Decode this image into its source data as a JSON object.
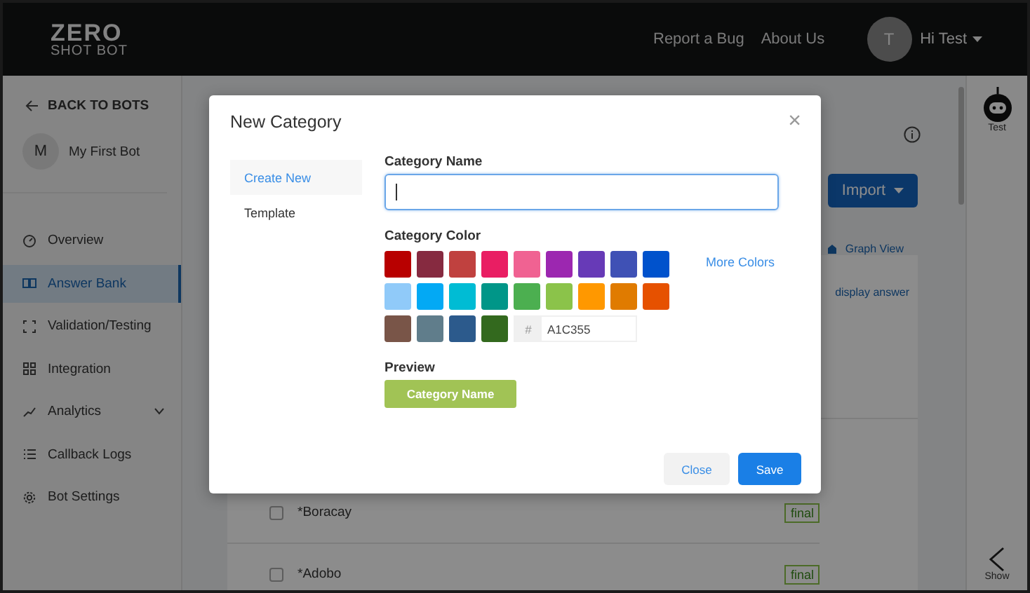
{
  "header": {
    "logo": {
      "word": "ZERO",
      "subtitle": "SHOT BOT"
    },
    "links": [
      "Report a Bug",
      "About Us"
    ],
    "user": {
      "initial": "T",
      "greeting": "Hi Test"
    }
  },
  "sidebar": {
    "back": "BACK TO BOTS",
    "bot": {
      "initial": "M",
      "name": "My First Bot"
    },
    "items": [
      {
        "label": "Overview",
        "kind": "link",
        "selected": false
      },
      {
        "label": "Answer Bank",
        "kind": "link",
        "selected": true
      },
      {
        "label": "Validation/Testing",
        "kind": "link",
        "selected": false
      },
      {
        "label": "Integration",
        "kind": "link",
        "selected": false
      },
      {
        "label": "Analytics",
        "kind": "group",
        "selected": false
      },
      {
        "label": "Callback Logs",
        "kind": "link",
        "selected": false
      },
      {
        "label": "Bot Settings",
        "kind": "link",
        "selected": false
      }
    ]
  },
  "main": {
    "import_button": "Import",
    "graph_view": "Graph View",
    "cut_text": "display answer",
    "rows": [
      {
        "name": "*Boracay",
        "checked": false,
        "status": "final"
      },
      {
        "name": "*Adobo",
        "checked": false,
        "status": "final"
      }
    ]
  },
  "rail": {
    "test": "Test",
    "show": "Show"
  },
  "modal": {
    "title": "New Category",
    "close": "×",
    "tabs": [
      {
        "label": "Create New",
        "selected": true
      },
      {
        "label": "Template",
        "selected": false
      }
    ],
    "name_label": "Category Name",
    "name_focused": true,
    "color_label": "Category Color",
    "swatches": [
      {
        "color": "#b80000"
      },
      {
        "color": "#862a40"
      },
      {
        "color": "#c0413f"
      },
      {
        "color": "#e91e63"
      },
      {
        "color": "#f06292"
      },
      {
        "color": "#9c27b0"
      },
      {
        "color": "#673ab7"
      },
      {
        "color": "#3f51b5"
      },
      {
        "color": "#0052cc"
      },
      {
        "color": "#90caf9"
      },
      {
        "color": "#03a9f4"
      },
      {
        "color": "#00bcd4"
      },
      {
        "color": "#009688"
      },
      {
        "color": "#4caf50"
      },
      {
        "color": "#8bc34a"
      },
      {
        "color": "#ff9800"
      },
      {
        "color": "#e07b00"
      },
      {
        "color": "#e65100"
      },
      {
        "color": "#795548"
      },
      {
        "color": "#607d8b"
      },
      {
        "color": "#2c5a8c"
      },
      {
        "color": "#33691e"
      }
    ],
    "more_colors": "More Colors",
    "hex_prefix": "#",
    "hex_value": "A1C355",
    "preview_label": "Preview",
    "preview_text": "Category Name",
    "buttons": [
      {
        "label": "Close",
        "kind": "secondary"
      },
      {
        "label": "Save",
        "kind": "primary"
      }
    ]
  }
}
